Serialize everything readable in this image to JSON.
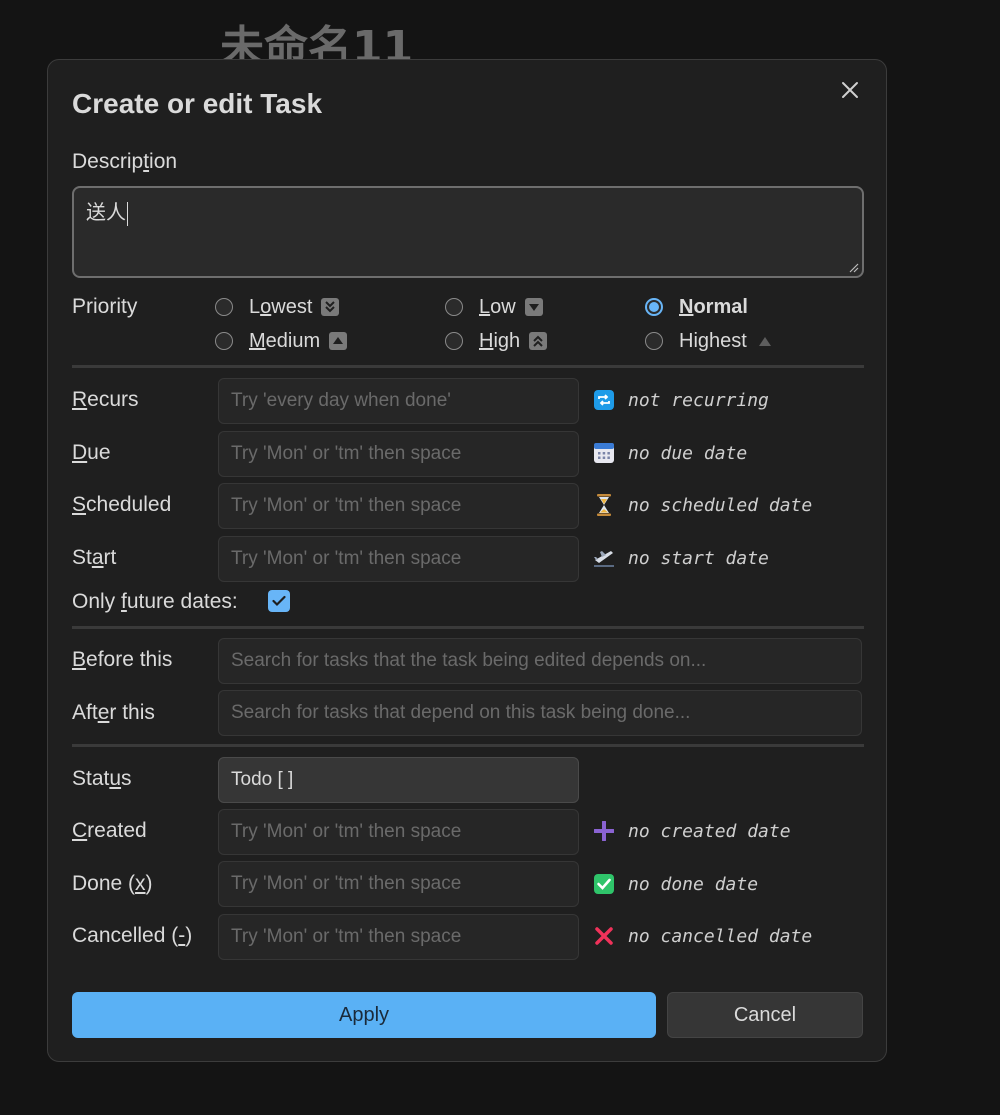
{
  "background": {
    "note_title": "未命名11"
  },
  "dialog": {
    "title": "Create or edit Task",
    "description": {
      "label_pre": "Descrip",
      "label_key": "t",
      "label_post": "ion",
      "value": "送人"
    },
    "priority": {
      "label": "Priority",
      "selected": "Normal",
      "options": [
        {
          "pre": "L",
          "key": "o",
          "post": "west",
          "icon": "double-down-arrow-icon"
        },
        {
          "pre": "",
          "key": "L",
          "post": "ow",
          "icon": "down-arrow-icon"
        },
        {
          "pre": "",
          "key": "N",
          "post": "ormal",
          "icon": ""
        },
        {
          "pre": "",
          "key": "M",
          "post": "edium",
          "icon": "up-arrow-icon"
        },
        {
          "pre": "",
          "key": "H",
          "post": "igh",
          "icon": "double-up-arrow-icon"
        },
        {
          "pre": "Hi",
          "key": "g",
          "post": "hest",
          "icon": "triangle-up-icon"
        }
      ]
    },
    "recurs": {
      "pre": "",
      "key": "R",
      "post": "ecurs",
      "placeholder": "Try 'every day when done'",
      "note": "not recurring",
      "icon": "repeat-icon"
    },
    "due": {
      "pre": "",
      "key": "D",
      "post": "ue",
      "placeholder": "Try 'Mon' or 'tm' then space",
      "note": "no due date",
      "icon": "calendar-icon"
    },
    "scheduled": {
      "pre": "",
      "key": "S",
      "post": "cheduled",
      "placeholder": "Try 'Mon' or 'tm' then space",
      "note": "no scheduled date",
      "icon": "hourglass-icon"
    },
    "start": {
      "pre": "St",
      "key": "a",
      "post": "rt",
      "placeholder": "Try 'Mon' or 'tm' then space",
      "note": "no start date",
      "icon": "airplane-departure-icon"
    },
    "future_dates": {
      "pre": "Only ",
      "key": "f",
      "post": "uture dates:",
      "checked": true
    },
    "before_this": {
      "pre": "",
      "key": "B",
      "post": "efore this",
      "placeholder": "Search for tasks that the task being edited depends on..."
    },
    "after_this": {
      "pre": "Aft",
      "key": "e",
      "post": "r this",
      "placeholder": "Search for tasks that depend on this task being done..."
    },
    "status": {
      "pre": "Stat",
      "key": "u",
      "post": "s",
      "value": "Todo [ ]"
    },
    "created": {
      "pre": "",
      "key": "C",
      "post": "reated",
      "placeholder": "Try 'Mon' or 'tm' then space",
      "note": "no created date",
      "icon": "plus-icon"
    },
    "done": {
      "pre": "Done (",
      "key": "x",
      "post": ")",
      "placeholder": "Try 'Mon' or 'tm' then space",
      "note": "no done date",
      "icon": "check-mark-icon"
    },
    "cancelled": {
      "pre": "Cancelled (",
      "key": "-",
      "post": ")",
      "placeholder": "Try 'Mon' or 'tm' then space",
      "note": "no cancelled date",
      "icon": "cross-mark-icon"
    },
    "apply_label": "Apply",
    "cancel_label": "Cancel"
  },
  "colors": {
    "accent": "#5ab1f5",
    "background": "#141414",
    "dialog": "#1f1f1f"
  }
}
